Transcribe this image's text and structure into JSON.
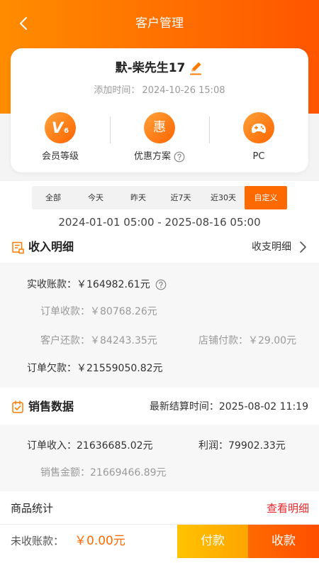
{
  "header": {
    "title": "客户管理"
  },
  "customer": {
    "name": "默-柴先生17",
    "added_label": "添加时间：",
    "added_time": "2024-10-26 15:08"
  },
  "profile": {
    "member_level": {
      "label": "会员等级",
      "badge_main": "V",
      "badge_sub": "6"
    },
    "discount": {
      "label": "优惠方案",
      "badge": "惠"
    },
    "device": {
      "label": "PC"
    }
  },
  "date_tabs": [
    {
      "label": "全部",
      "selected": false
    },
    {
      "label": "今天",
      "selected": false
    },
    {
      "label": "昨天",
      "selected": false
    },
    {
      "label": "近7天",
      "selected": false
    },
    {
      "label": "近30天",
      "selected": false
    },
    {
      "label": "自定义",
      "selected": true
    }
  ],
  "date_range": "2024-01-01 05:00 - 2025-08-16 05:00",
  "income": {
    "title": "收入明细",
    "detail_link": "收支明细",
    "received": {
      "label": "实收账款：",
      "value": "￥164982.61元"
    },
    "order_payment": {
      "label": "订单收款：",
      "value": "￥80768.26元"
    },
    "customer_repayment": {
      "label": "客户还款：",
      "value": "￥84243.35元"
    },
    "store_payment": {
      "label": "店铺付款：",
      "value": "￥29.00元"
    },
    "order_debt": {
      "label": "订单欠款：",
      "value": "￥21559050.82元"
    }
  },
  "sales": {
    "title": "销售数据",
    "settle_label": "最新结算时间：",
    "settle_time": "2025-08-02 11:19",
    "order_income": {
      "label": "订单收入：",
      "value": "21636685.02元"
    },
    "profit": {
      "label": "利润：",
      "value": "79902.33元"
    },
    "sales_amount": {
      "label": "销售金额：",
      "value": "21669466.89元"
    }
  },
  "goods": {
    "title": "商品统计",
    "detail_link": "查看明细"
  },
  "footer": {
    "unpaid_label": "未收账款：",
    "unpaid_value": "￥0.00元",
    "pay_button": "付款",
    "collect_button": "收款"
  },
  "colors": {
    "accent": "#ff6a00",
    "header_start": "#ff8c00",
    "header_end": "#ff5500",
    "link_red": "#e8262a",
    "pay_button": "#ffb300",
    "collect_button": "#ff5a00"
  },
  "icons": {
    "back": "back-icon",
    "edit": "edit-icon",
    "member_level": "vip-level-icon",
    "discount": "discount-icon",
    "device": "gamepad-icon",
    "help": "help-icon",
    "income": "document-icon",
    "chevron": "chevron-right-icon",
    "sales": "clipboard-check-icon"
  }
}
